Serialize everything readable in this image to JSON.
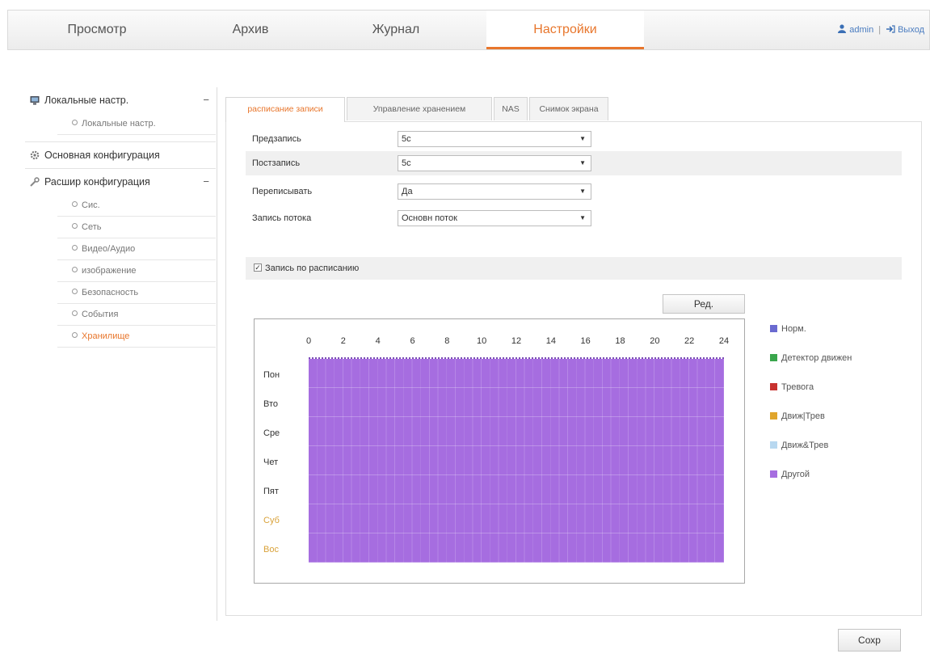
{
  "topnav": {
    "tabs": [
      {
        "label": "Просмотр",
        "active": false
      },
      {
        "label": "Архив",
        "active": false
      },
      {
        "label": "Журнал",
        "active": false
      },
      {
        "label": "Настройки",
        "active": true
      }
    ],
    "user": "admin",
    "separator": "|",
    "logout": "Выход"
  },
  "sidebar": {
    "local": {
      "label": "Локальные настр.",
      "toggle": "−",
      "items": [
        "Локальные настр."
      ]
    },
    "basic": {
      "label": "Основная конфигурация"
    },
    "advanced": {
      "label": "Расшир конфигурация",
      "toggle": "−",
      "items": [
        "Сис.",
        "Сеть",
        "Видео/Аудио",
        "изображение",
        "Безопасность",
        "События",
        "Хранилище"
      ],
      "active_item": "Хранилище"
    }
  },
  "content_tabs": [
    {
      "label": "расписание записи",
      "active": true
    },
    {
      "label": "Управление хранением",
      "active": false
    },
    {
      "label": "NAS",
      "active": false
    },
    {
      "label": "Снимок экрана",
      "active": false
    }
  ],
  "form": {
    "prerecord": {
      "label": "Предзапись",
      "value": "5с"
    },
    "postrecord": {
      "label": "Постзапись",
      "value": "5с"
    },
    "overwrite": {
      "label": "Переписывать",
      "value": "Да"
    },
    "stream": {
      "label": "Запись потока",
      "value": "Основн поток"
    }
  },
  "schedule": {
    "enabled": true,
    "checkbox_label": "Запись по расписанию",
    "edit_button": "Ред.",
    "hours": [
      "0",
      "2",
      "4",
      "6",
      "8",
      "10",
      "12",
      "14",
      "16",
      "18",
      "20",
      "22",
      "24"
    ],
    "days": [
      {
        "label": "Пон",
        "weekend": false
      },
      {
        "label": "Вто",
        "weekend": false
      },
      {
        "label": "Сре",
        "weekend": false
      },
      {
        "label": "Чет",
        "weekend": false
      },
      {
        "label": "Пят",
        "weekend": false
      },
      {
        "label": "Суб",
        "weekend": true
      },
      {
        "label": "Вос",
        "weekend": true
      }
    ],
    "fill_type": "Другой",
    "fill_color": "#a66de0"
  },
  "legend": [
    {
      "label": "Норм.",
      "color": "#6a6ad0"
    },
    {
      "label": "Детектор движен",
      "color": "#3aa64c"
    },
    {
      "label": "Тревога",
      "color": "#c8322f"
    },
    {
      "label": "Движ|Трев",
      "color": "#e0a52c"
    },
    {
      "label": "Движ&Трев",
      "color": "#b8d8f0"
    },
    {
      "label": "Другой",
      "color": "#a66de0"
    }
  ],
  "save_button": "Сохр",
  "colors": {
    "accent": "#e8762c",
    "link": "#4a7cc0"
  }
}
